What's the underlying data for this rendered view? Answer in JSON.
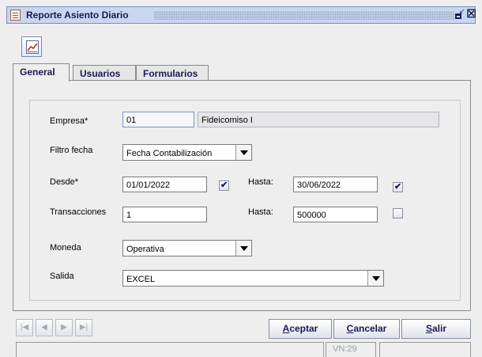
{
  "window": {
    "title": "Reporte Asiento Diario"
  },
  "tabs": [
    {
      "label": "General"
    },
    {
      "label": "Usuarios"
    },
    {
      "label": "Formularios"
    }
  ],
  "form": {
    "empresa": {
      "label": "Empresa*",
      "code": "01",
      "name": "Fideicomiso I"
    },
    "filtro_fecha": {
      "label": "Filtro fecha",
      "value": "Fecha Contabilización"
    },
    "desde": {
      "label": "Desde*",
      "value": "01/01/2022",
      "checked": true
    },
    "hasta_fecha": {
      "label": "Hasta:",
      "value": "30/06/2022",
      "checked": true
    },
    "transacciones": {
      "label": "Transacciones",
      "value": "1"
    },
    "hasta_trans": {
      "label": "Hasta:",
      "value": "500000",
      "checked": false
    },
    "moneda": {
      "label": "Moneda",
      "value": "Operativa"
    },
    "salida": {
      "label": "Salida",
      "value": "EXCEL"
    }
  },
  "nav": {
    "first": "|◀",
    "prev": "◀",
    "next": "▶",
    "last": "▶|"
  },
  "buttons": {
    "aceptar": {
      "mnemonic": "A",
      "rest": "ceptar"
    },
    "cancelar": {
      "mnemonic": "C",
      "rest": "ancelar"
    },
    "salir": {
      "mnemonic": "S",
      "rest": "alir"
    }
  },
  "status": {
    "vn": "VN:29"
  },
  "icons": {
    "window": "document-icon",
    "toolbar": "chart-report-icon",
    "check": "✔"
  }
}
